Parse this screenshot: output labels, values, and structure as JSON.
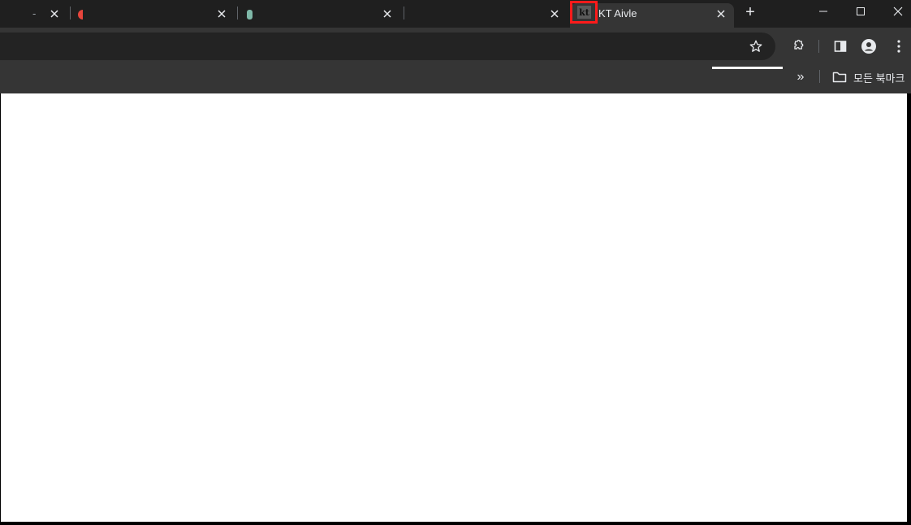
{
  "tabs": [
    {
      "title": "-",
      "active": false
    },
    {
      "title": "",
      "active": false
    },
    {
      "title": "",
      "active": false
    },
    {
      "title": "",
      "active": false
    },
    {
      "title": "KT Aivle",
      "active": true
    }
  ],
  "active_tab_favicon_text": "kt",
  "new_tab_label": "+",
  "bookmarks": {
    "overflow_label": "»",
    "folder_label": "모든 북마크"
  },
  "colors": {
    "highlight": "#ff1a1a",
    "tabstrip": "#1f1f1f",
    "toolbar": "#353535",
    "omnibox": "#232323"
  }
}
